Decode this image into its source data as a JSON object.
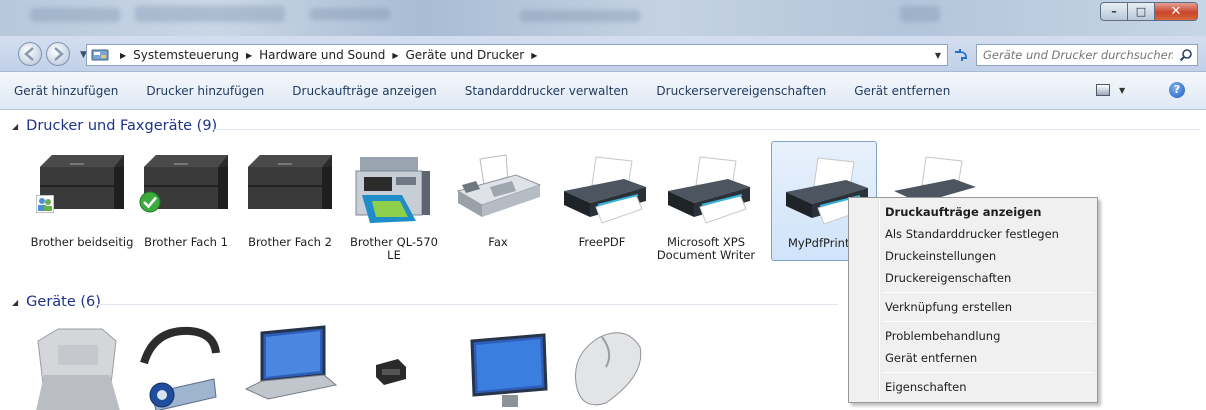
{
  "window": {
    "minimize_glyph": "–",
    "maximize_glyph": "□",
    "close_glyph": "✕"
  },
  "address": {
    "crumbs": [
      "Systemsteuerung",
      "Hardware und Sound",
      "Geräte und Drucker"
    ],
    "search_placeholder": "Geräte und Drucker durchsuchen"
  },
  "toolbar": {
    "items": [
      "Gerät hinzufügen",
      "Drucker hinzufügen",
      "Druckaufträge anzeigen",
      "Standarddrucker verwalten",
      "Druckerservereigenschaften",
      "Gerät entfernen"
    ],
    "help_glyph": "?"
  },
  "groups": {
    "printers": {
      "title": "Drucker und Faxgeräte (9)",
      "items": [
        {
          "label": "Brother beidseitig",
          "icon": "laser-printer-icon"
        },
        {
          "label": "Brother Fach 1",
          "icon": "laser-printer-icon"
        },
        {
          "label": "Brother Fach 2",
          "icon": "laser-printer-icon"
        },
        {
          "label": "Brother QL-570 LE",
          "icon": "label-printer-icon"
        },
        {
          "label": "Fax",
          "icon": "fax-icon"
        },
        {
          "label": "FreePDF",
          "icon": "printer-icon"
        },
        {
          "label": "Microsoft XPS Document Writer",
          "icon": "printer-icon"
        },
        {
          "label": "MyPdfPrint",
          "icon": "printer-icon"
        }
      ]
    },
    "devices": {
      "title": "Geräte (6)"
    }
  },
  "context_menu": {
    "items": [
      "Druckaufträge anzeigen",
      "Als Standarddrucker festlegen",
      "Druckeinstellungen",
      "Druckereigenschaften",
      "Verknüpfung erstellen",
      "Problembehandlung",
      "Gerät entfernen",
      "Eigenschaften"
    ]
  },
  "colors": {
    "accent": "#1e3287",
    "selection": "#cfe3fa",
    "close_button": "#c9442a"
  }
}
